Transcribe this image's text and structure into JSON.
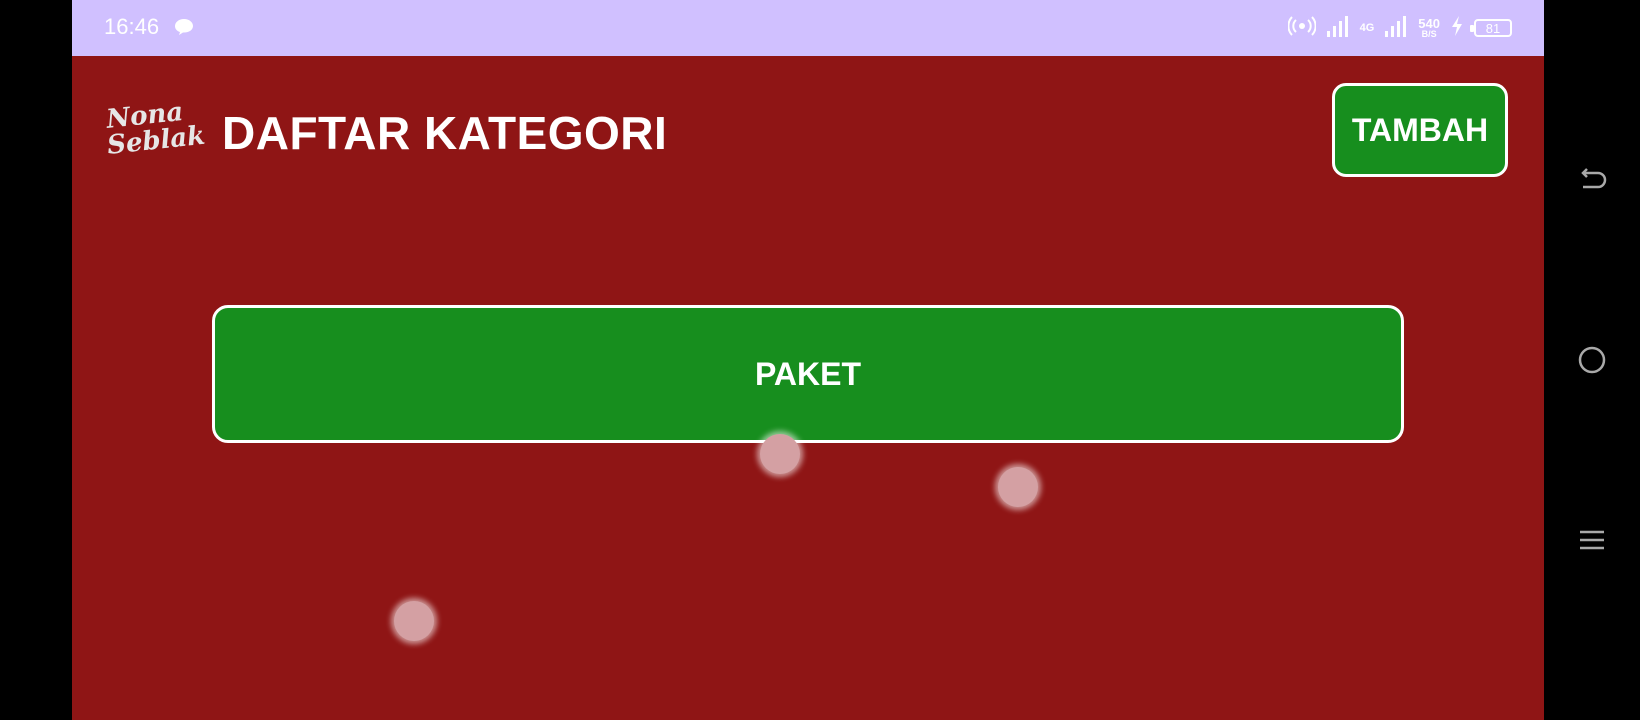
{
  "status_bar": {
    "time": "16:46",
    "network_type": "4G",
    "network_speed_value": "540",
    "network_speed_unit": "B/S",
    "battery_level": "81",
    "icons": [
      "message-icon",
      "hotspot-icon",
      "signal-icon",
      "signal-icon",
      "charging-icon",
      "battery-icon"
    ]
  },
  "header": {
    "logo_line1": "Nona",
    "logo_line2": "Seblak",
    "title": "DAFTAR KATEGORI",
    "add_button_label": "TAMBAH"
  },
  "categories": [
    {
      "label": "PAKET"
    }
  ],
  "navbar": {
    "icons": [
      "back-icon",
      "home-icon",
      "menu-icon"
    ]
  },
  "colors": {
    "background": "#8f1515",
    "status_bar": "#d0c0ff",
    "button": "#178e1e",
    "button_border": "#ffffff",
    "text": "#ffffff"
  }
}
